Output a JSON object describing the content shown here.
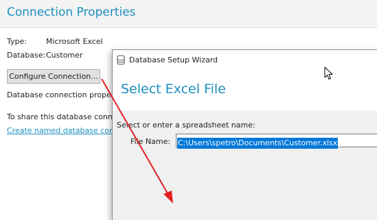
{
  "connection_properties": {
    "title": "Connection Properties",
    "type_label": "Type:",
    "type_value": "Microsoft Excel",
    "database_label": "Database:",
    "database_value": "Customer",
    "configure_button": "Configure Connection...",
    "connection_text": "Database connection proper",
    "share_text": "To share this database conne",
    "named_link": "Create named database conn"
  },
  "wizard": {
    "window_title": "Database Setup Wizard",
    "icon": "database-icon",
    "heading": "Select Excel File",
    "prompt": "Select or enter a spreadsheet name:",
    "file_name_label": "File Name:",
    "file_name_value": "C:\\Users\\spetro\\Documents\\Customer.xlsx"
  },
  "colors": {
    "accent": "#1c8fc0",
    "annotation_arrow": "#e02020",
    "selection": "#0078d7"
  }
}
